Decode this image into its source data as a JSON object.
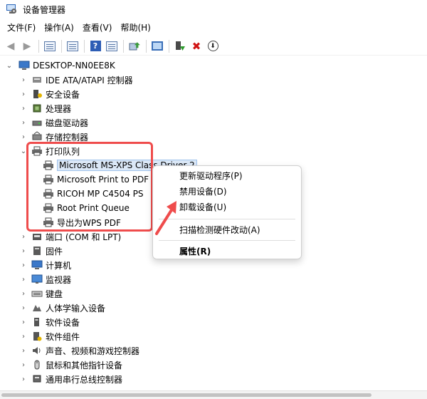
{
  "window": {
    "title": "设备管理器"
  },
  "menu": [
    "文件(F)",
    "操作(A)",
    "查看(V)",
    "帮助(H)"
  ],
  "toolbar": {
    "icons": [
      "back-arrow-icon",
      "forward-arrow-icon",
      "show-hide-tree-icon",
      "properties-icon",
      "help-icon",
      "view-icon",
      "update-driver-icon",
      "scan-hardware-icon",
      "enable-device-icon",
      "uninstall-device-icon",
      "disable-device-icon"
    ]
  },
  "tree": {
    "root": "DESKTOP-NN0EE8K",
    "categories": [
      "IDE ATA/ATAPI 控制器",
      "安全设备",
      "处理器",
      "磁盘驱动器",
      "存储控制器",
      "打印队列",
      "端口 (COM 和 LPT)",
      "固件",
      "计算机",
      "监视器",
      "键盘",
      "人体学输入设备",
      "软件设备",
      "软件组件",
      "声音、视频和游戏控制器",
      "鼠标和其他指针设备",
      "通用串行总线控制器"
    ],
    "print_queue_children": [
      "Microsoft MS-XPS Class Driver 2",
      "Microsoft Print to PDF",
      "RICOH MP C4504 PS",
      "Root Print Queue",
      "导出为WPS PDF"
    ]
  },
  "context_menu": {
    "items": [
      "更新驱动程序(P)",
      "禁用设备(D)",
      "卸载设备(U)",
      "扫描检测硬件改动(A)",
      "属性(R)"
    ]
  },
  "colors": {
    "highlight_box": "#ef4c4c",
    "selection": "#dbe8f7",
    "accent": "#2d5db5"
  }
}
